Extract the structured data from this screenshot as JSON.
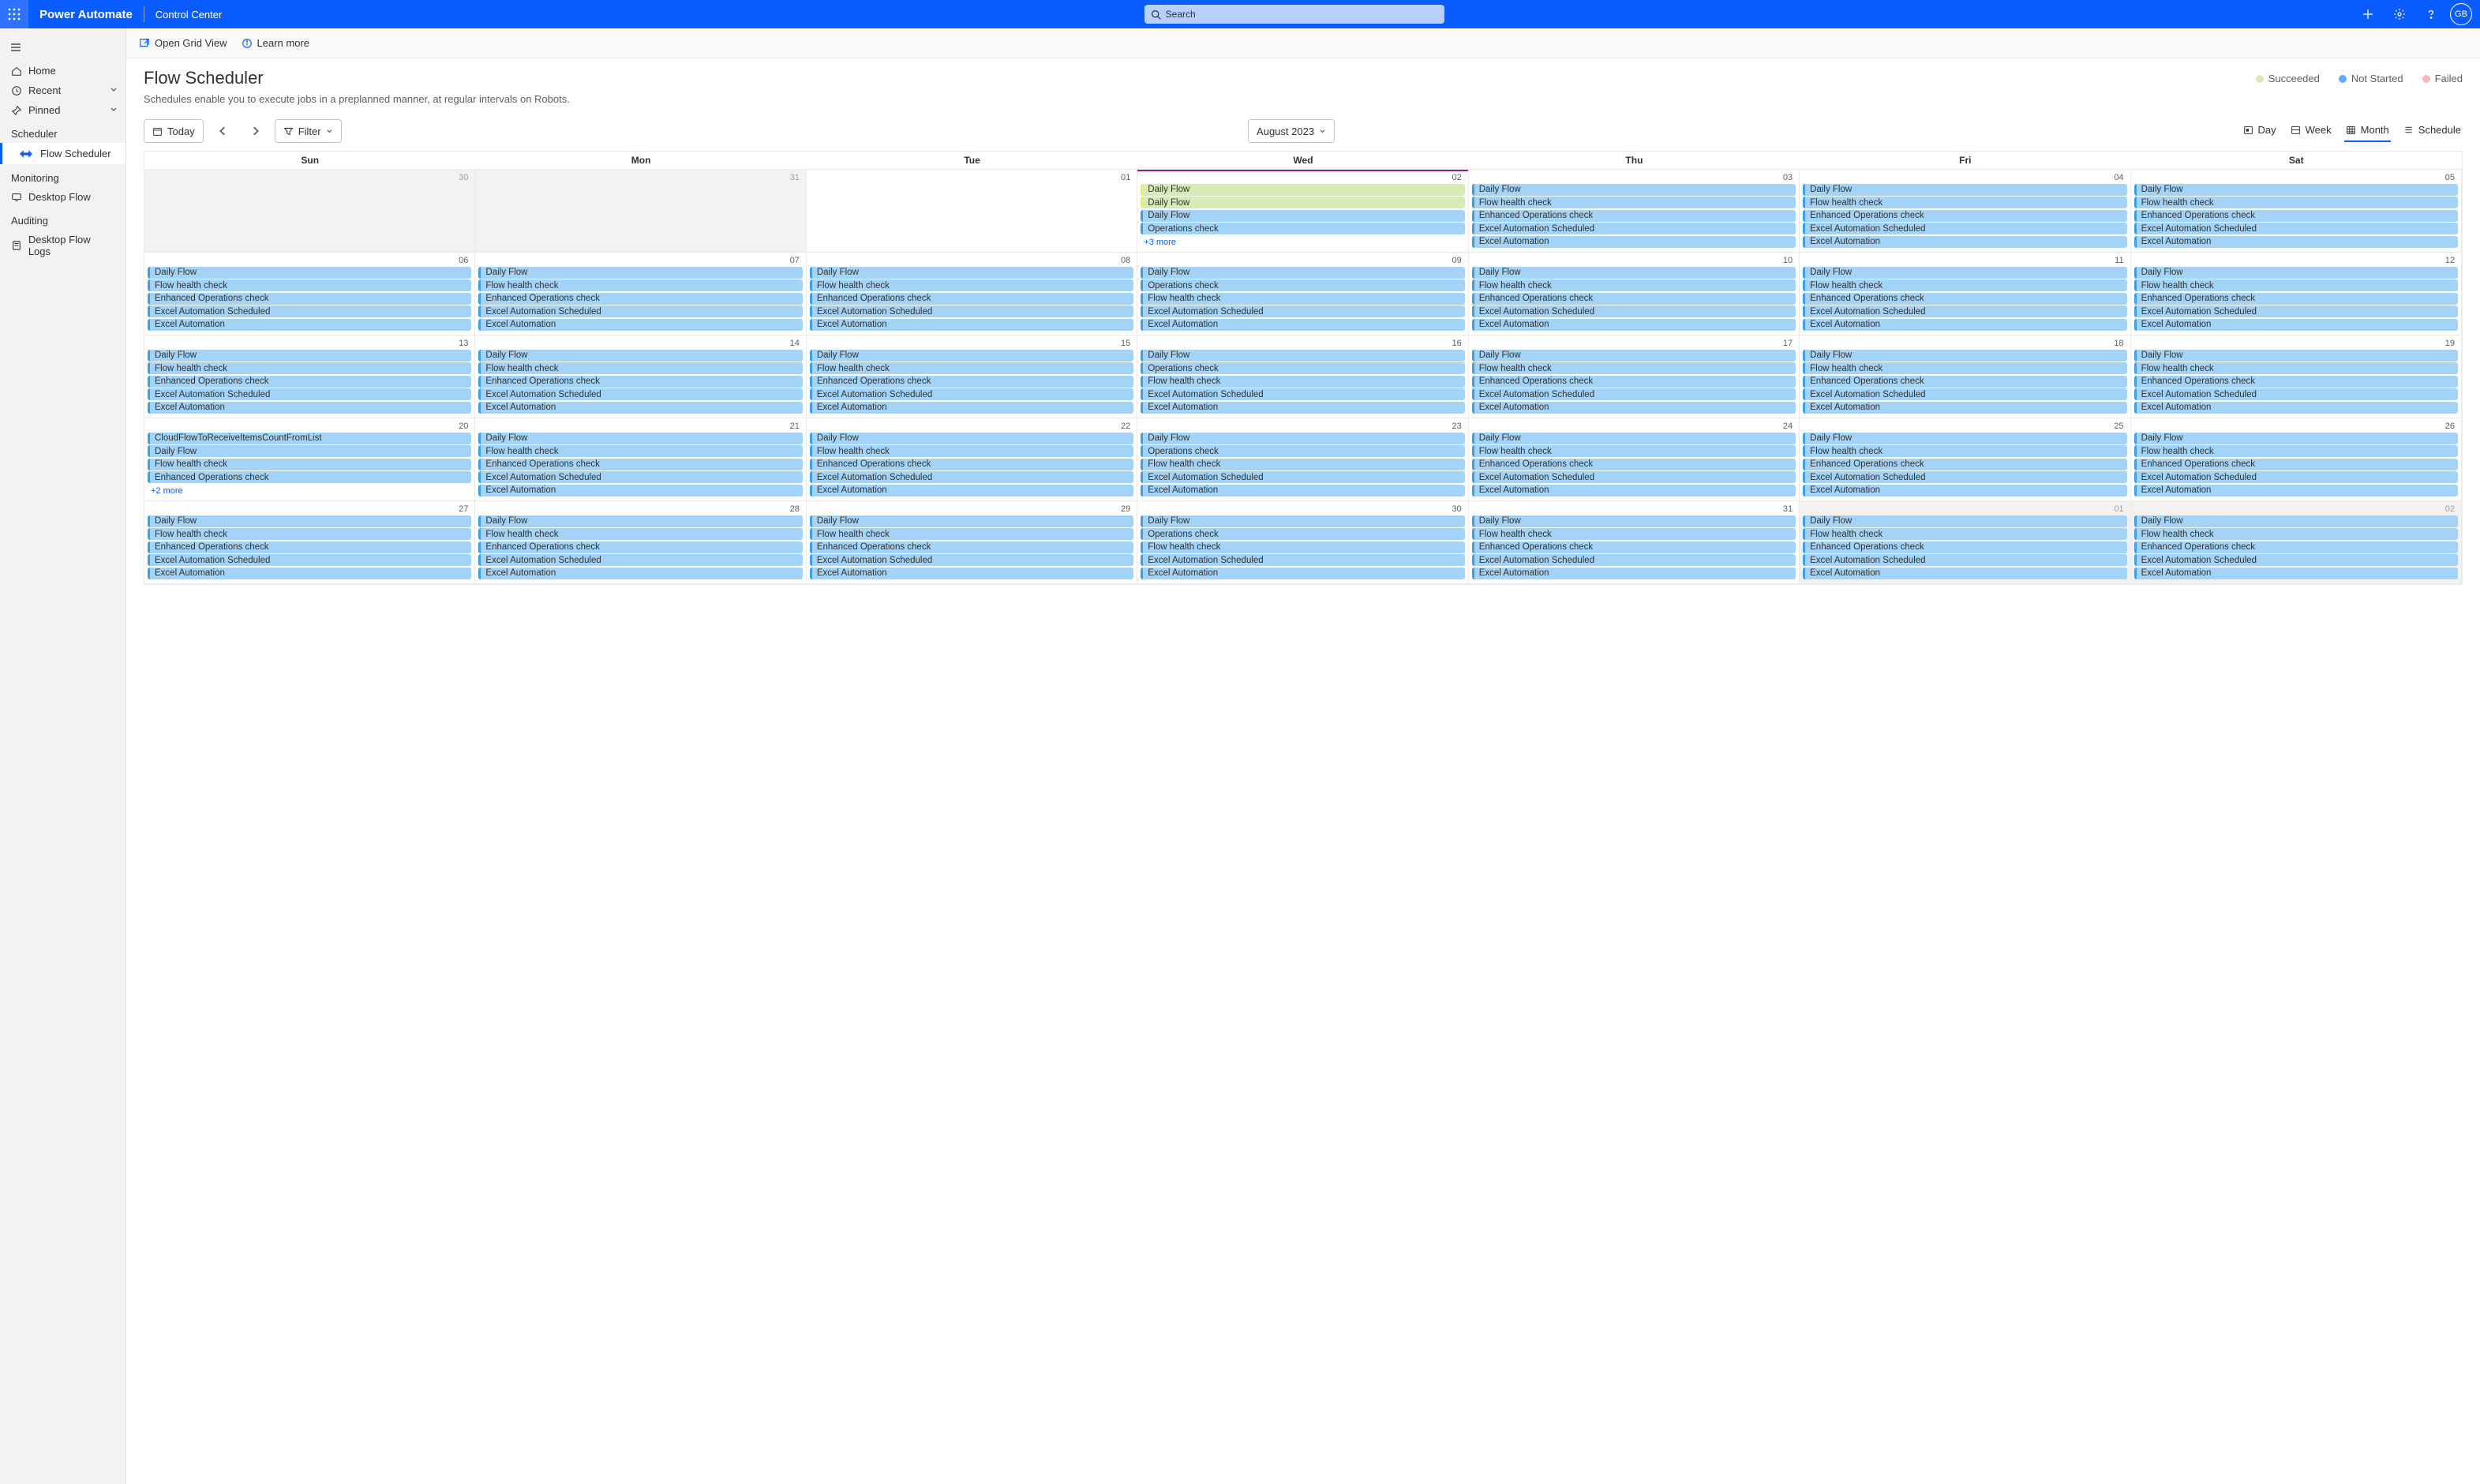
{
  "header": {
    "brand": "Power Automate",
    "sub": "Control Center",
    "search_placeholder": "Search",
    "avatar_initials": "GB"
  },
  "sidebar": {
    "home": "Home",
    "recent": "Recent",
    "pinned": "Pinned",
    "scheduler_group": "Scheduler",
    "flow_scheduler": "Flow Scheduler",
    "monitoring_group": "Monitoring",
    "desktop_flow": "Desktop Flow",
    "auditing_group": "Auditing",
    "desktop_flow_logs": "Desktop Flow Logs"
  },
  "commands": {
    "open_grid": "Open Grid View",
    "learn_more": "Learn more"
  },
  "page": {
    "title": "Flow Scheduler",
    "desc": "Schedules enable you to execute jobs in a preplanned manner, at regular intervals on Robots."
  },
  "legend": {
    "succeeded": "Succeeded",
    "not_started": "Not Started",
    "failed": "Failed",
    "colors": {
      "succeeded": "#d8eab6",
      "not_started": "#6aa9ff",
      "failed": "#f7b9b9"
    }
  },
  "toolbar": {
    "today": "Today",
    "filter": "Filter",
    "month_label": "August 2023",
    "views": {
      "day": "Day",
      "week": "Week",
      "month": "Month",
      "schedule": "Schedule",
      "active": "month"
    }
  },
  "calendar": {
    "dow": [
      "Sun",
      "Mon",
      "Tue",
      "Wed",
      "Thu",
      "Fri",
      "Sat"
    ],
    "today_column_index": 3,
    "cells": [
      {
        "n": "30",
        "dim": true,
        "events": []
      },
      {
        "n": "31",
        "dim": true,
        "events": []
      },
      {
        "n": "01",
        "events": [],
        "today_marker": false
      },
      {
        "n": "02",
        "today_marker": true,
        "events": [
          {
            "t": "Daily Flow",
            "s": "succ"
          },
          {
            "t": "Daily Flow",
            "s": "succ"
          },
          {
            "t": "Daily Flow"
          },
          {
            "t": "Operations check"
          }
        ],
        "more": "+3 more"
      },
      {
        "n": "03",
        "events": [
          {
            "t": "Daily Flow"
          },
          {
            "t": "Flow health check"
          },
          {
            "t": "Enhanced Operations check"
          },
          {
            "t": "Excel Automation Scheduled"
          },
          {
            "t": "Excel Automation"
          }
        ]
      },
      {
        "n": "04",
        "events": [
          {
            "t": "Daily Flow"
          },
          {
            "t": "Flow health check"
          },
          {
            "t": "Enhanced Operations check"
          },
          {
            "t": "Excel Automation Scheduled"
          },
          {
            "t": "Excel Automation"
          }
        ]
      },
      {
        "n": "05",
        "events": [
          {
            "t": "Daily Flow"
          },
          {
            "t": "Flow health check"
          },
          {
            "t": "Enhanced Operations check"
          },
          {
            "t": "Excel Automation Scheduled"
          },
          {
            "t": "Excel Automation"
          }
        ]
      },
      {
        "n": "06",
        "events": [
          {
            "t": "Daily Flow"
          },
          {
            "t": "Flow health check"
          },
          {
            "t": "Enhanced Operations check"
          },
          {
            "t": "Excel Automation Scheduled"
          },
          {
            "t": "Excel Automation"
          }
        ]
      },
      {
        "n": "07",
        "events": [
          {
            "t": "Daily Flow"
          },
          {
            "t": "Flow health check"
          },
          {
            "t": "Enhanced Operations check"
          },
          {
            "t": "Excel Automation Scheduled"
          },
          {
            "t": "Excel Automation"
          }
        ]
      },
      {
        "n": "08",
        "events": [
          {
            "t": "Daily Flow"
          },
          {
            "t": "Flow health check"
          },
          {
            "t": "Enhanced Operations check"
          },
          {
            "t": "Excel Automation Scheduled"
          },
          {
            "t": "Excel Automation"
          }
        ]
      },
      {
        "n": "09",
        "events": [
          {
            "t": "Daily Flow"
          },
          {
            "t": "Operations check"
          },
          {
            "t": "Flow health check"
          },
          {
            "t": "Excel Automation Scheduled"
          },
          {
            "t": "Excel Automation"
          }
        ]
      },
      {
        "n": "10",
        "events": [
          {
            "t": "Daily Flow"
          },
          {
            "t": "Flow health check"
          },
          {
            "t": "Enhanced Operations check"
          },
          {
            "t": "Excel Automation Scheduled"
          },
          {
            "t": "Excel Automation"
          }
        ]
      },
      {
        "n": "11",
        "events": [
          {
            "t": "Daily Flow"
          },
          {
            "t": "Flow health check"
          },
          {
            "t": "Enhanced Operations check"
          },
          {
            "t": "Excel Automation Scheduled"
          },
          {
            "t": "Excel Automation"
          }
        ]
      },
      {
        "n": "12",
        "events": [
          {
            "t": "Daily Flow"
          },
          {
            "t": "Flow health check"
          },
          {
            "t": "Enhanced Operations check"
          },
          {
            "t": "Excel Automation Scheduled"
          },
          {
            "t": "Excel Automation"
          }
        ]
      },
      {
        "n": "13",
        "events": [
          {
            "t": "Daily Flow"
          },
          {
            "t": "Flow health check"
          },
          {
            "t": "Enhanced Operations check"
          },
          {
            "t": "Excel Automation Scheduled"
          },
          {
            "t": "Excel Automation"
          }
        ]
      },
      {
        "n": "14",
        "events": [
          {
            "t": "Daily Flow"
          },
          {
            "t": "Flow health check"
          },
          {
            "t": "Enhanced Operations check"
          },
          {
            "t": "Excel Automation Scheduled"
          },
          {
            "t": "Excel Automation"
          }
        ]
      },
      {
        "n": "15",
        "events": [
          {
            "t": "Daily Flow"
          },
          {
            "t": "Flow health check"
          },
          {
            "t": "Enhanced Operations check"
          },
          {
            "t": "Excel Automation Scheduled"
          },
          {
            "t": "Excel Automation"
          }
        ]
      },
      {
        "n": "16",
        "events": [
          {
            "t": "Daily Flow"
          },
          {
            "t": "Operations check"
          },
          {
            "t": "Flow health check"
          },
          {
            "t": "Excel Automation Scheduled"
          },
          {
            "t": "Excel Automation"
          }
        ]
      },
      {
        "n": "17",
        "events": [
          {
            "t": "Daily Flow"
          },
          {
            "t": "Flow health check"
          },
          {
            "t": "Enhanced Operations check"
          },
          {
            "t": "Excel Automation Scheduled"
          },
          {
            "t": "Excel Automation"
          }
        ]
      },
      {
        "n": "18",
        "events": [
          {
            "t": "Daily Flow"
          },
          {
            "t": "Flow health check"
          },
          {
            "t": "Enhanced Operations check"
          },
          {
            "t": "Excel Automation Scheduled"
          },
          {
            "t": "Excel Automation"
          }
        ]
      },
      {
        "n": "19",
        "events": [
          {
            "t": "Daily Flow"
          },
          {
            "t": "Flow health check"
          },
          {
            "t": "Enhanced Operations check"
          },
          {
            "t": "Excel Automation Scheduled"
          },
          {
            "t": "Excel Automation"
          }
        ]
      },
      {
        "n": "20",
        "events": [
          {
            "t": "CloudFlowToReceiveItemsCountFromList"
          },
          {
            "t": "Daily Flow"
          },
          {
            "t": "Flow health check"
          },
          {
            "t": "Enhanced Operations check"
          }
        ],
        "more": "+2 more"
      },
      {
        "n": "21",
        "events": [
          {
            "t": "Daily Flow"
          },
          {
            "t": "Flow health check"
          },
          {
            "t": "Enhanced Operations check"
          },
          {
            "t": "Excel Automation Scheduled"
          },
          {
            "t": "Excel Automation"
          }
        ]
      },
      {
        "n": "22",
        "events": [
          {
            "t": "Daily Flow"
          },
          {
            "t": "Flow health check"
          },
          {
            "t": "Enhanced Operations check"
          },
          {
            "t": "Excel Automation Scheduled"
          },
          {
            "t": "Excel Automation"
          }
        ]
      },
      {
        "n": "23",
        "events": [
          {
            "t": "Daily Flow"
          },
          {
            "t": "Operations check"
          },
          {
            "t": "Flow health check"
          },
          {
            "t": "Excel Automation Scheduled"
          },
          {
            "t": "Excel Automation"
          }
        ]
      },
      {
        "n": "24",
        "events": [
          {
            "t": "Daily Flow"
          },
          {
            "t": "Flow health check"
          },
          {
            "t": "Enhanced Operations check"
          },
          {
            "t": "Excel Automation Scheduled"
          },
          {
            "t": "Excel Automation"
          }
        ]
      },
      {
        "n": "25",
        "events": [
          {
            "t": "Daily Flow"
          },
          {
            "t": "Flow health check"
          },
          {
            "t": "Enhanced Operations check"
          },
          {
            "t": "Excel Automation Scheduled"
          },
          {
            "t": "Excel Automation"
          }
        ]
      },
      {
        "n": "26",
        "events": [
          {
            "t": "Daily Flow"
          },
          {
            "t": "Flow health check"
          },
          {
            "t": "Enhanced Operations check"
          },
          {
            "t": "Excel Automation Scheduled"
          },
          {
            "t": "Excel Automation"
          }
        ]
      },
      {
        "n": "27",
        "events": [
          {
            "t": "Daily Flow"
          },
          {
            "t": "Flow health check"
          },
          {
            "t": "Enhanced Operations check"
          },
          {
            "t": "Excel Automation Scheduled"
          },
          {
            "t": "Excel Automation"
          }
        ]
      },
      {
        "n": "28",
        "events": [
          {
            "t": "Daily Flow"
          },
          {
            "t": "Flow health check"
          },
          {
            "t": "Enhanced Operations check"
          },
          {
            "t": "Excel Automation Scheduled"
          },
          {
            "t": "Excel Automation"
          }
        ]
      },
      {
        "n": "29",
        "events": [
          {
            "t": "Daily Flow"
          },
          {
            "t": "Flow health check"
          },
          {
            "t": "Enhanced Operations check"
          },
          {
            "t": "Excel Automation Scheduled"
          },
          {
            "t": "Excel Automation"
          }
        ]
      },
      {
        "n": "30",
        "events": [
          {
            "t": "Daily Flow"
          },
          {
            "t": "Operations check"
          },
          {
            "t": "Flow health check"
          },
          {
            "t": "Excel Automation Scheduled"
          },
          {
            "t": "Excel Automation"
          }
        ]
      },
      {
        "n": "31",
        "events": [
          {
            "t": "Daily Flow"
          },
          {
            "t": "Flow health check"
          },
          {
            "t": "Enhanced Operations check"
          },
          {
            "t": "Excel Automation Scheduled"
          },
          {
            "t": "Excel Automation"
          }
        ]
      },
      {
        "n": "01",
        "dim": true,
        "events": [
          {
            "t": "Daily Flow"
          },
          {
            "t": "Flow health check"
          },
          {
            "t": "Enhanced Operations check"
          },
          {
            "t": "Excel Automation Scheduled"
          },
          {
            "t": "Excel Automation"
          }
        ]
      },
      {
        "n": "02",
        "dim": true,
        "events": [
          {
            "t": "Daily Flow"
          },
          {
            "t": "Flow health check"
          },
          {
            "t": "Enhanced Operations check"
          },
          {
            "t": "Excel Automation Scheduled"
          },
          {
            "t": "Excel Automation"
          }
        ]
      }
    ]
  }
}
